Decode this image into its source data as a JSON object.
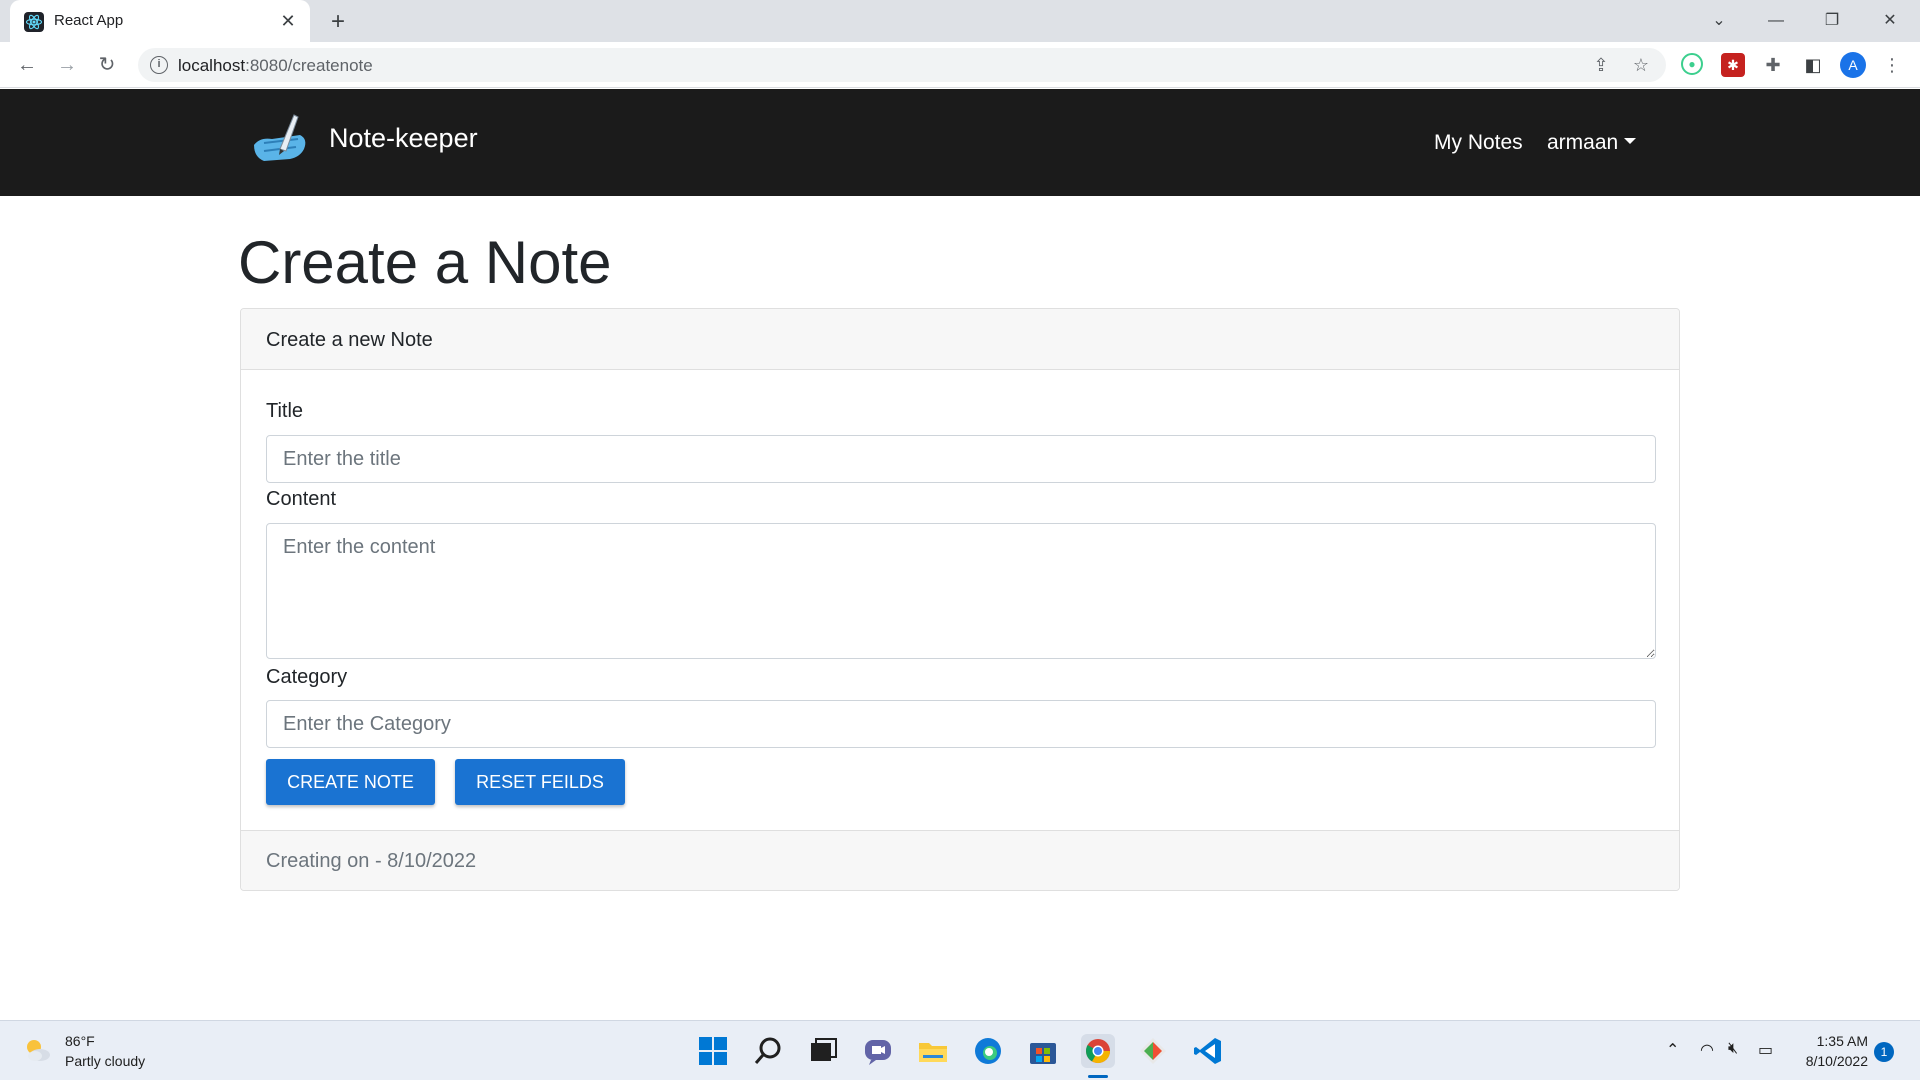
{
  "browser": {
    "tab_title": "React App",
    "url_host": "localhost",
    "url_rest": ":8080/createnote",
    "profile_initial": "A"
  },
  "navbar": {
    "brand": "Note-keeper",
    "links": {
      "my_notes": "My Notes",
      "user": "armaan"
    }
  },
  "page": {
    "title": "Create a Note",
    "card_header": "Create a new Note",
    "form": {
      "title_label": "Title",
      "title_placeholder": "Enter the title",
      "content_label": "Content",
      "content_placeholder": "Enter the content",
      "category_label": "Category",
      "category_placeholder": "Enter the Category"
    },
    "buttons": {
      "create": "CREATE NOTE",
      "reset": "RESET FEILDS"
    },
    "footer": "Creating on - 8/10/2022"
  },
  "taskbar": {
    "weather_temp": "86°F",
    "weather_desc": "Partly cloudy",
    "time": "1:35 AM",
    "date": "8/10/2022",
    "notifications": "1"
  },
  "colors": {
    "navbar_bg": "#1b1b1b",
    "primary_button": "#1a73d2",
    "accent": "#1a73e8"
  }
}
